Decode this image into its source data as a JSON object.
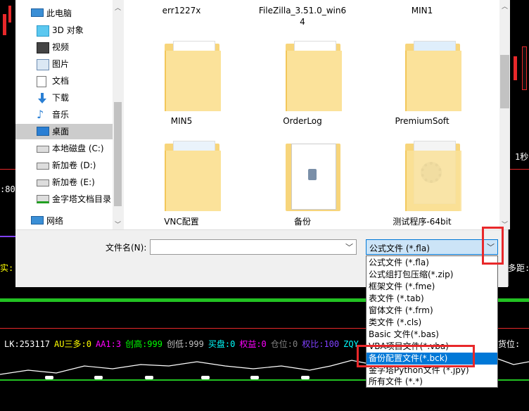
{
  "sidebar": {
    "items": [
      {
        "label": "此电脑",
        "icon": "computer-icon"
      },
      {
        "label": "3D 对象",
        "icon": "3d-objects-icon"
      },
      {
        "label": "视频",
        "icon": "video-icon"
      },
      {
        "label": "图片",
        "icon": "pictures-icon"
      },
      {
        "label": "文档",
        "icon": "documents-icon"
      },
      {
        "label": "下载",
        "icon": "download-icon"
      },
      {
        "label": "音乐",
        "icon": "music-icon"
      },
      {
        "label": "桌面",
        "icon": "desktop-icon"
      },
      {
        "label": "本地磁盘 (C:)",
        "icon": "drive-icon"
      },
      {
        "label": "新加卷 (D:)",
        "icon": "drive-icon"
      },
      {
        "label": "新加卷 (E:)",
        "icon": "drive-icon"
      },
      {
        "label": "金字塔文档目录",
        "icon": "network-drive-icon"
      },
      {
        "label": "网络",
        "icon": "network-icon"
      }
    ]
  },
  "files": {
    "top_row": [
      "err1227x",
      "FileZilla_3.51.0_win6",
      "4",
      "MIN1"
    ],
    "items": [
      {
        "label": "MIN5",
        "icon": "folder-icon"
      },
      {
        "label": "OrderLog",
        "icon": "folder-icon"
      },
      {
        "label": "PremiumSoft",
        "icon": "folder-icon"
      },
      {
        "label": "VNC配置",
        "icon": "folder-icon"
      },
      {
        "label": "备份",
        "icon": "file-icon"
      },
      {
        "label": "测试程序-64bit",
        "icon": "folder-icon"
      }
    ]
  },
  "filename": {
    "label": "文件名(N):",
    "value": ""
  },
  "filetype": {
    "selected": "公式文件 (*.fla)",
    "options": [
      "公式文件 (*.fla)",
      "公式组打包压缩(*.zip)",
      "框架文件 (*.fme)",
      "表文件 (*.tab)",
      "窗体文件 (*.frm)",
      "类文件 (*.cls)",
      "Basic 文件(*.bas)",
      "VBA项目文件(*.vba)",
      "备份配置文件(*.bck)",
      "金字塔Python文件 (*.jpy)",
      "所有文件 (*.*)"
    ],
    "highlighted_index": 8
  },
  "background": {
    "left_numbers": [
      ":80",
      "实:"
    ],
    "right_labels": [
      "1秒",
      "多距:",
      "货位:"
    ],
    "indicator_line": [
      {
        "text": "LK:253117",
        "color": "#ffffff"
      },
      {
        "text": "AU三多:0",
        "color": "#ffff00"
      },
      {
        "text": "AA1:3",
        "color": "#ff00ff"
      },
      {
        "text": "创高:999",
        "color": "#00ff00"
      },
      {
        "text": "创低:999",
        "color": "#c0c0c0"
      },
      {
        "text": "买盘:0",
        "color": "#00ffff"
      },
      {
        "text": "权益:0",
        "color": "#ff00ff"
      },
      {
        "text": "仓位:0",
        "color": "#808080"
      },
      {
        "text": "权比:100",
        "color": "#8040ff"
      },
      {
        "text": "ZQY",
        "color": "#00ffff"
      }
    ]
  },
  "colors": {
    "accent": "#0078d7",
    "annotation": "#e8282a",
    "folder": "#f7d57b"
  }
}
